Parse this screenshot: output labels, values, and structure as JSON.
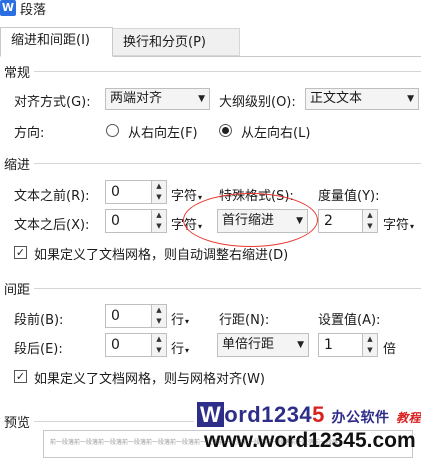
{
  "window": {
    "title": "段落",
    "icon_letter": "W"
  },
  "tabs": [
    {
      "label": "缩进和间距(I)",
      "active": true
    },
    {
      "label": "换行和分页(P)",
      "active": false
    }
  ],
  "general": {
    "heading": "常规",
    "alignment_label": "对齐方式(G):",
    "alignment_value": "两端对齐",
    "outline_label": "大纲级别(O):",
    "outline_value": "正文文本",
    "direction_label": "方向:",
    "rtl_label": "从右向左(F)",
    "ltr_label": "从左向右(L)",
    "direction_selected": "ltr"
  },
  "indent": {
    "heading": "缩进",
    "before_label": "文本之前(R):",
    "before_value": "0",
    "before_unit": "字符",
    "after_label": "文本之后(X):",
    "after_value": "0",
    "after_unit": "字符",
    "special_label": "特殊格式(S):",
    "special_value": "首行缩进",
    "measure_label": "度量值(Y):",
    "measure_value": "2",
    "measure_unit": "字符",
    "grid_checkbox_label": "如果定义了文档网格，则自动调整右缩进(D)",
    "grid_checked": true
  },
  "spacing": {
    "heading": "间距",
    "before_label": "段前(B):",
    "before_value": "0",
    "before_unit": "行",
    "after_label": "段后(E):",
    "after_value": "0",
    "after_unit": "行",
    "line_label": "行距(N):",
    "line_value": "单倍行距",
    "setting_label": "设置值(A):",
    "setting_value": "1",
    "setting_unit": "倍",
    "grid_checkbox_label": "如果定义了文档网格，则与网格对齐(W)",
    "grid_checked": true
  },
  "preview": {
    "heading": "预览",
    "sample_text": "前一段落前一段落前一段落前一段落前一段落前一段落前一段落前一段落前一段落前一段落前一段落前一段落"
  },
  "watermark": {
    "logo_w": "W",
    "logo_ord": "ord",
    "logo_1234": "1234",
    "logo_5": "5",
    "logo_cn": "办公软件",
    "logo_cn2": "教程",
    "url": "www.word12345.com"
  },
  "colors": {
    "annotation_ellipse": "#e8382f",
    "brand_blue": "#2e2e8a",
    "brand_red": "#d92121"
  }
}
